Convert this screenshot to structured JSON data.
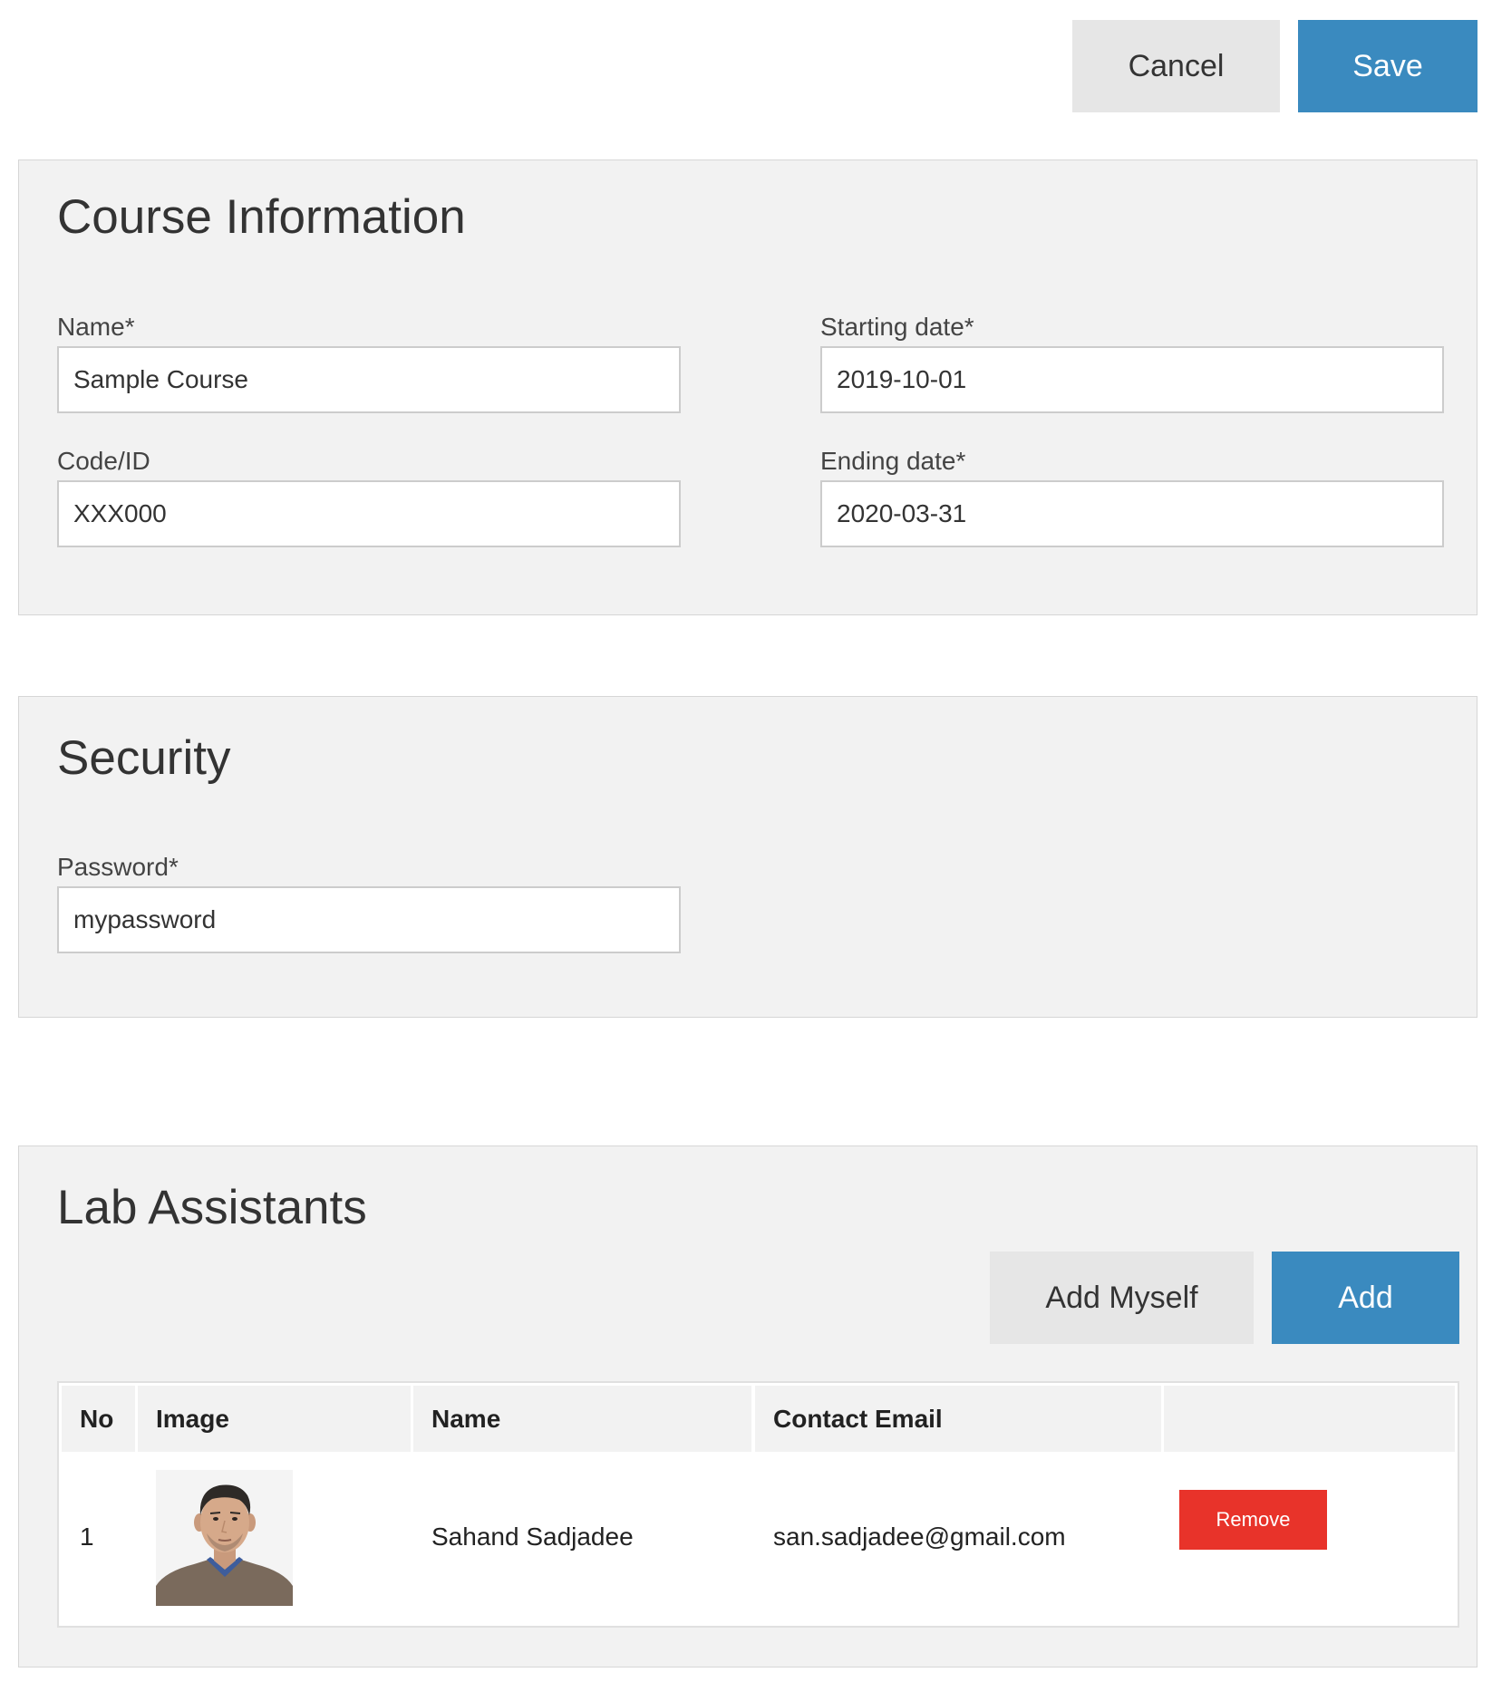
{
  "toolbar": {
    "cancel_label": "Cancel",
    "save_label": "Save"
  },
  "course_info": {
    "title": "Course Information",
    "name": {
      "label": "Name*",
      "value": "Sample Course"
    },
    "code": {
      "label": "Code/ID",
      "value": "XXX000"
    },
    "start_date": {
      "label": "Starting date*",
      "value": "2019-10-01"
    },
    "end_date": {
      "label": "Ending date*",
      "value": "2020-03-31"
    }
  },
  "security": {
    "title": "Security",
    "password": {
      "label": "Password*",
      "value": "mypassword"
    }
  },
  "lab_assistants": {
    "title": "Lab Assistants",
    "add_myself_label": "Add Myself",
    "add_label": "Add",
    "columns": [
      "No",
      "Image",
      "Name",
      "Contact Email",
      ""
    ],
    "rows": [
      {
        "no": "1",
        "image": "person-photo",
        "name": "Sahand Sadjadee",
        "email": "san.sadjadee@gmail.com",
        "action_label": "Remove"
      }
    ]
  },
  "colors": {
    "primary": "#3a8abf",
    "secondary": "#e6e6e6",
    "danger": "#e8332a",
    "panel": "#f2f2f2"
  }
}
